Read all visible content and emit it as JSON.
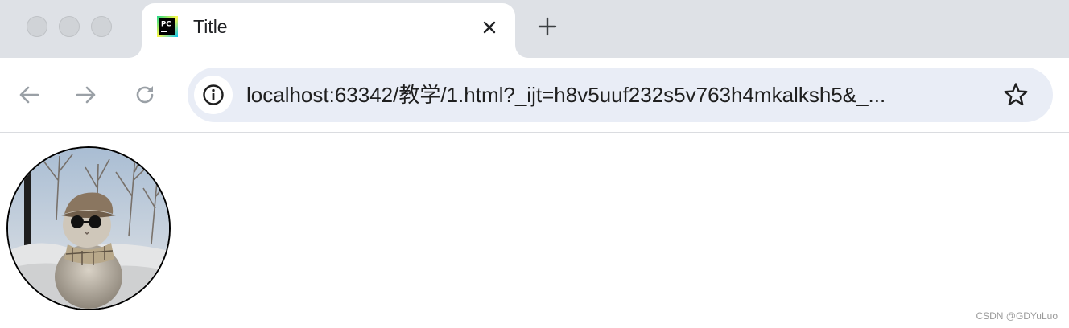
{
  "browser": {
    "tab": {
      "title": "Title",
      "favicon": "pycharm-icon",
      "favicon_text": "PC"
    },
    "toolbar": {
      "back_icon": "arrow-left-icon",
      "forward_icon": "arrow-right-icon",
      "reload_icon": "reload-icon",
      "site_info_icon": "info-icon",
      "url": "localhost:63342/教学/1.html?_ijt=h8v5uuf232s5v763h4mkalksh5&_...",
      "bookmark_icon": "star-icon"
    },
    "colors": {
      "tabstrip": "#dee1e6",
      "omnibox": "#e9edf6",
      "icon": "#5f6368"
    }
  },
  "page": {
    "avatar": "cat-photo",
    "watermark": "CSDN @GDYuLuo"
  }
}
